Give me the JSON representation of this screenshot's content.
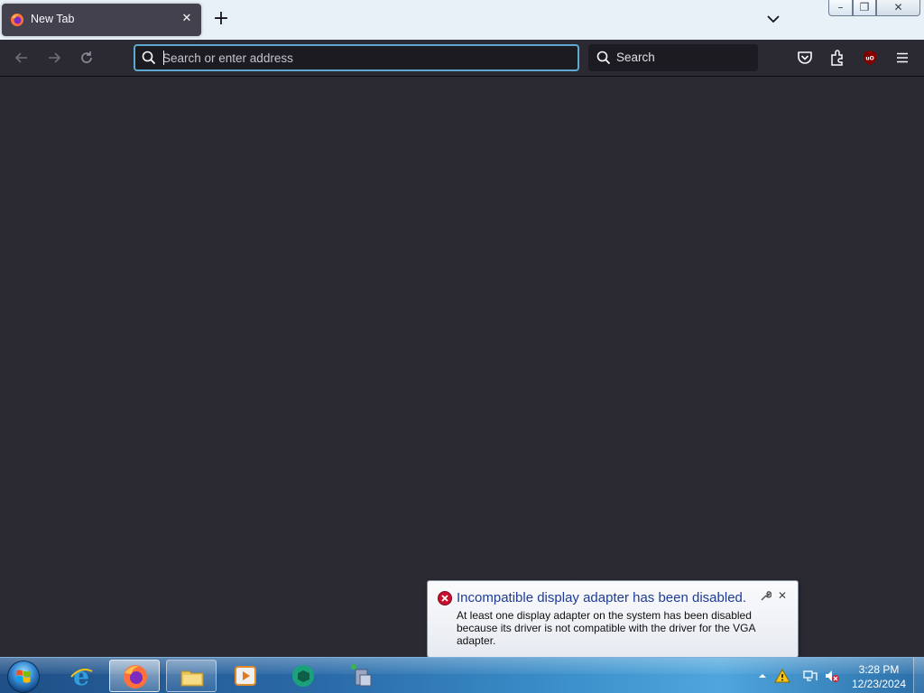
{
  "browser": {
    "tab": {
      "title": "New Tab",
      "favicon": "firefox-icon",
      "close_icon": "close-icon"
    },
    "newtab_icon": "plus-icon",
    "alltabs_icon": "chevron-down-icon",
    "window_controls": [
      "minimize-icon",
      "maximize-icon",
      "close-icon"
    ],
    "nav": {
      "back": "arrow-left-icon",
      "forward": "arrow-right-icon",
      "reload": "reload-icon"
    },
    "urlbar": {
      "placeholder": "Search or enter address",
      "value": ""
    },
    "searchbar": {
      "placeholder": "Search"
    },
    "toolbar": [
      "pocket-icon",
      "extensions-icon",
      "ublock-origin-icon",
      "menu-icon"
    ]
  },
  "notification": {
    "title": "Incompatible display adapter has been disabled.",
    "body": "At least one display adapter on the system has been disabled because its driver is not compatible with the driver for the VGA adapter.",
    "options_icon": "wrench-icon",
    "close_icon": "close-icon",
    "status_icon": "error-icon"
  },
  "taskbar": {
    "start_icon": "windows-start-orb-icon",
    "pinned": [
      "internet-explorer-icon",
      "firefox-icon",
      "file-explorer-icon",
      "media-player-icon",
      "browser-app-icon",
      "network-app-icon"
    ],
    "active_index": 1,
    "tray": [
      "show-hidden-icons-icon",
      "warning-icon",
      "network-icon",
      "volume-muted-icon"
    ],
    "clock": {
      "time": "3:28 PM",
      "date": "12/23/2024"
    }
  },
  "colors": {
    "content_bg": "#2b2a33",
    "tab_bg": "#42414d",
    "url_focus_border": "#5fa8cf",
    "notification_title": "#1e3c96"
  }
}
